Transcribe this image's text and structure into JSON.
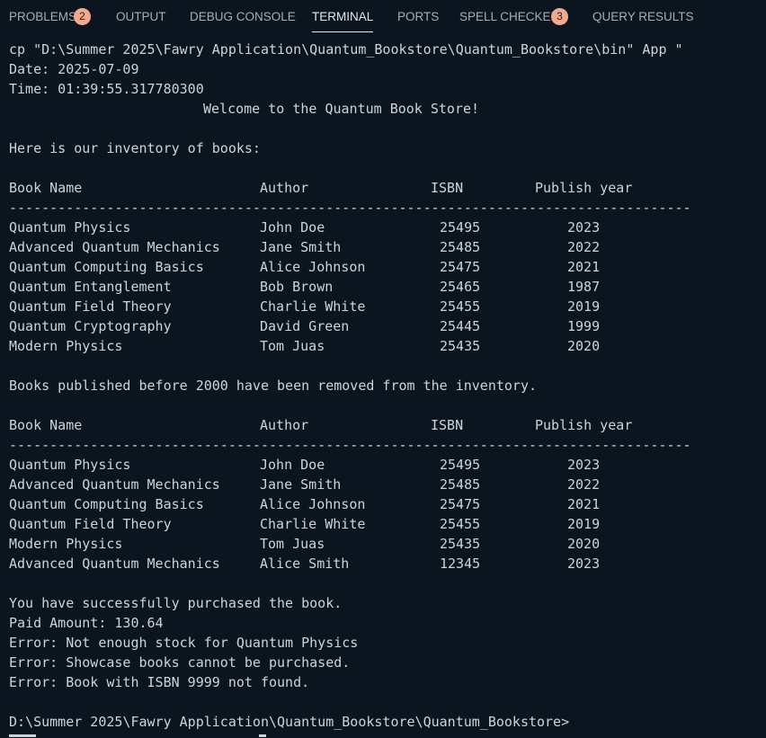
{
  "panel_tabs": [
    {
      "label": "PROBLEMS",
      "badge": "2"
    },
    {
      "label": "OUTPUT"
    },
    {
      "label": "DEBUG CONSOLE"
    },
    {
      "label": "TERMINAL"
    },
    {
      "label": "PORTS"
    },
    {
      "label": "SPELL CHECKER",
      "badge": "3"
    },
    {
      "label": "QUERY RESULTS"
    }
  ],
  "active_tab": "TERMINAL",
  "colors": {
    "background": "#0b1520",
    "text": "#cfd3d7",
    "badge": "#f5a98c",
    "tab_inactive": "#a9adb3",
    "tab_active": "#e6e6e6"
  },
  "terminal": {
    "command": "cp \"D:\\Summer 2025\\Fawry Application\\Quantum_Bookstore\\Quantum_Bookstore\\bin\" App \"",
    "date_line": "Date: 2025-07-09",
    "time_line": "Time: 01:39:55.317780300",
    "welcome": "Welcome to the Quantum Book Store!",
    "inventory_intro": "Here is our inventory of books:",
    "table_headers": [
      "Book Name",
      "Author",
      "ISBN",
      "Publish year"
    ],
    "separator": "------------------------------------------------------------------------------------",
    "inventory_rows": [
      [
        "Quantum Physics",
        "John Doe",
        "25495",
        "2023"
      ],
      [
        "Advanced Quantum Mechanics",
        "Jane Smith",
        "25485",
        "2022"
      ],
      [
        "Quantum Computing Basics",
        "Alice Johnson",
        "25475",
        "2021"
      ],
      [
        "Quantum Entanglement",
        "Bob Brown",
        "25465",
        "1987"
      ],
      [
        "Quantum Field Theory",
        "Charlie White",
        "25455",
        "2019"
      ],
      [
        "Quantum Cryptography",
        "David Green",
        "25445",
        "1999"
      ],
      [
        "Modern Physics",
        "Tom Juas",
        "25435",
        "2020"
      ]
    ],
    "removed_message": "Books published before 2000 have been removed from the inventory.",
    "remaining_rows": [
      [
        "Quantum Physics",
        "John Doe",
        "25495",
        "2023"
      ],
      [
        "Advanced Quantum Mechanics",
        "Jane Smith",
        "25485",
        "2022"
      ],
      [
        "Quantum Computing Basics",
        "Alice Johnson",
        "25475",
        "2021"
      ],
      [
        "Quantum Field Theory",
        "Charlie White",
        "25455",
        "2019"
      ],
      [
        "Modern Physics",
        "Tom Juas",
        "25435",
        "2020"
      ],
      [
        "Advanced Quantum Mechanics",
        "Alice Smith",
        "12345",
        "2023"
      ]
    ],
    "purchase_success": "You have successfully purchased the book.",
    "paid_amount": "Paid Amount: 130.64",
    "error_stock": "Error: Not enough stock for Quantum Physics",
    "error_showcase": "Error: Showcase books cannot be purchased.",
    "error_isbn": "Error: Book with ISBN 9999 not found.",
    "prompt": "D:\\Summer 2025\\Fawry Application\\Quantum_Bookstore\\Quantum_Bookstore>"
  }
}
